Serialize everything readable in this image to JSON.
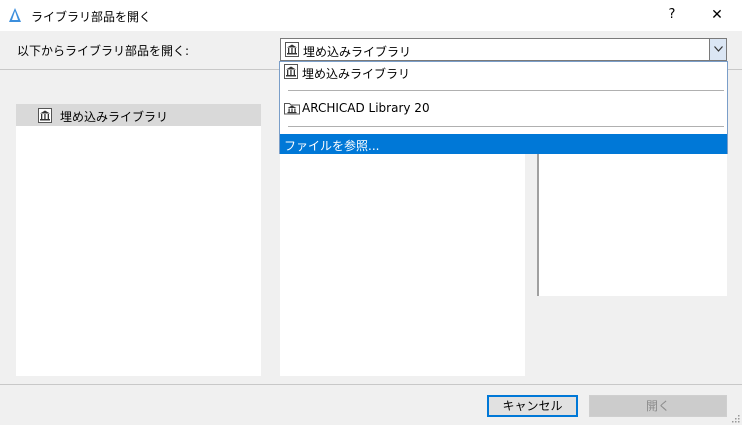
{
  "window": {
    "title": "ライブラリ部品を開く",
    "help_label": "?",
    "close_label": "✕"
  },
  "prompt": "以下からライブラリ部品を開く:",
  "combo": {
    "selected": "埋め込みライブラリ"
  },
  "dropdown": {
    "items": [
      {
        "label": "埋め込みライブラリ"
      },
      {
        "label": "ARCHICAD Library 20"
      },
      {
        "label": "ファイルを参照..."
      }
    ]
  },
  "tree": {
    "items": [
      {
        "label": "埋め込みライブラリ"
      }
    ]
  },
  "buttons": {
    "cancel": "キャンセル",
    "open": "開く"
  },
  "colors": {
    "accent": "#0078d7",
    "selected_row": "#d9d9d9"
  }
}
